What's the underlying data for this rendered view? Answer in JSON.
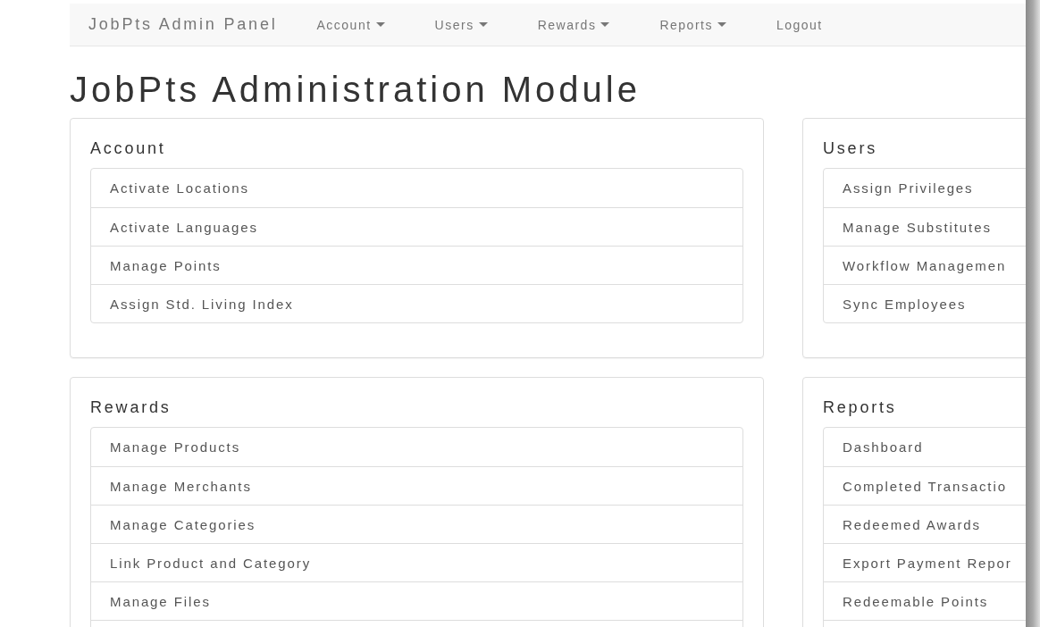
{
  "navbar": {
    "brand": "JobPts Admin Panel",
    "items": [
      {
        "label": "Account",
        "dropdown": true
      },
      {
        "label": "Users",
        "dropdown": true
      },
      {
        "label": "Rewards",
        "dropdown": true
      },
      {
        "label": "Reports",
        "dropdown": true
      },
      {
        "label": "Logout",
        "dropdown": false
      }
    ]
  },
  "page_title": "JobPts Administration Module",
  "panels": [
    {
      "title": "Account",
      "items": [
        "Activate Locations",
        "Activate Languages",
        "Manage Points",
        "Assign Std. Living Index"
      ],
      "continues": false
    },
    {
      "title": "Users",
      "items": [
        "Assign Privileges",
        "Manage Substitutes",
        "Workflow Managemen",
        "Sync Employees"
      ],
      "continues": false
    },
    {
      "title": "Rewards",
      "items": [
        "Manage Products",
        "Manage Merchants",
        "Manage Categories",
        "Link Product and Category",
        "Manage Files"
      ],
      "continues": true
    },
    {
      "title": "Reports",
      "items": [
        "Dashboard",
        "Completed Transactio",
        "Redeemed Awards",
        "Export Payment Repor",
        "Redeemable Points"
      ],
      "continues": true
    }
  ]
}
